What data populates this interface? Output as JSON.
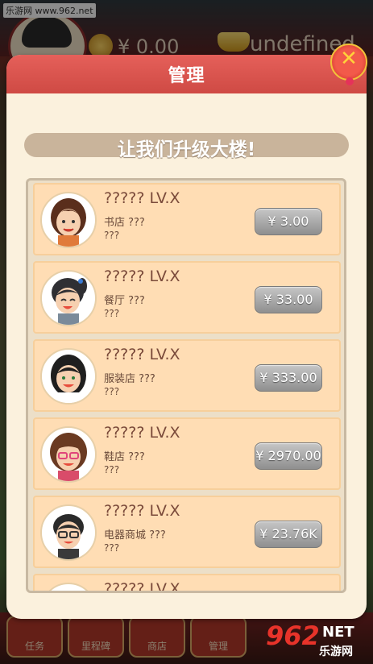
{
  "background": {
    "site_label": "乐游网 www.962.net",
    "money": "¥ 0.00",
    "gold": "undefined",
    "bottom_tabs": [
      {
        "label": "任务"
      },
      {
        "label": "里程碑"
      },
      {
        "label": "商店"
      },
      {
        "label": "管理"
      }
    ],
    "watermark_big": "962",
    "watermark_net": "NET",
    "watermark_sub": "乐游网"
  },
  "modal": {
    "title": "管理",
    "close_icon": "close-x-icon",
    "banner": "让我们升级大楼!",
    "rows": [
      {
        "title": "????? LV.X",
        "shop": "书店 ???",
        "extra": "???",
        "price": "¥ 3.00",
        "avatar": "woman-brown-hair-avatar"
      },
      {
        "title": "????? LV.X",
        "shop": "餐厅 ???",
        "extra": "???",
        "price": "¥ 33.00",
        "avatar": "girl-ponytail-avatar"
      },
      {
        "title": "????? LV.X",
        "shop": "服装店 ???",
        "extra": "???",
        "price": "¥ 333.00",
        "avatar": "woman-dark-hair-avatar"
      },
      {
        "title": "????? LV.X",
        "shop": "鞋店 ???",
        "extra": "???",
        "price": "¥ 2970.00",
        "avatar": "woman-glasses-avatar"
      },
      {
        "title": "????? LV.X",
        "shop": "电器商城 ???",
        "extra": "???",
        "price": "¥ 23.76K",
        "avatar": "man-glasses-avatar"
      },
      {
        "title": "????? LV.X",
        "shop": "",
        "extra": "",
        "price": "",
        "avatar": "partial-avatar"
      }
    ]
  },
  "colors": {
    "header_red": "#e5605a",
    "row_bg": "#ffddb4",
    "price_button": "#a8a8a8"
  }
}
